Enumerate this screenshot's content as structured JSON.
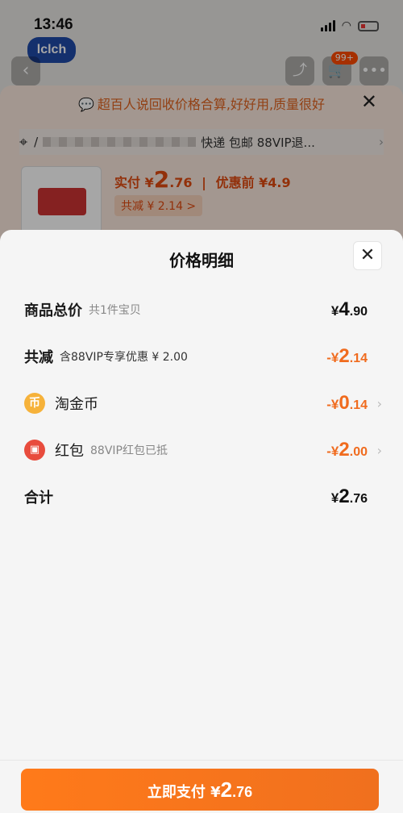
{
  "status_bar": {
    "time": "13:46"
  },
  "background": {
    "brand_logo": "lclch",
    "cart_badge": "99+",
    "promo_text": "超百人说回收价格合算,好好用,质量很好",
    "address_prefix": "/",
    "shipping_text": "快递 包邮 88VIP退...",
    "price_label": "实付",
    "price_currency": "¥",
    "price_int": "2",
    "price_dec": ".76",
    "price_before": "优惠前 ¥4.9",
    "discount_chip": "共减 ¥ 2.14 >"
  },
  "sheet": {
    "title": "价格明细",
    "rows": [
      {
        "label": "商品总价",
        "sub": "共1件宝贝",
        "cur": "¥",
        "int": "4",
        "dec": ".90"
      },
      {
        "label": "共减",
        "sub": "含88VIP专享优惠 ¥ 2.00",
        "cur": "-¥",
        "int": "2",
        "dec": ".14"
      },
      {
        "label": "淘金币",
        "sub": "",
        "cur": "-¥",
        "int": "0",
        "dec": ".14",
        "icon": "coin-icon"
      },
      {
        "label": "红包",
        "sub": "88VIP红包已抵",
        "cur": "-¥",
        "int": "2",
        "dec": ".00",
        "icon": "red-packet-icon"
      },
      {
        "label": "合计",
        "sub": "",
        "cur": "¥",
        "int": "2",
        "dec": ".76"
      }
    ]
  },
  "footer": {
    "pay_label": "立即支付",
    "pay_currency": "¥",
    "pay_int": "2",
    "pay_dec": ".76"
  },
  "colors": {
    "accent": "#f06b1e",
    "promo": "#e0631f"
  }
}
